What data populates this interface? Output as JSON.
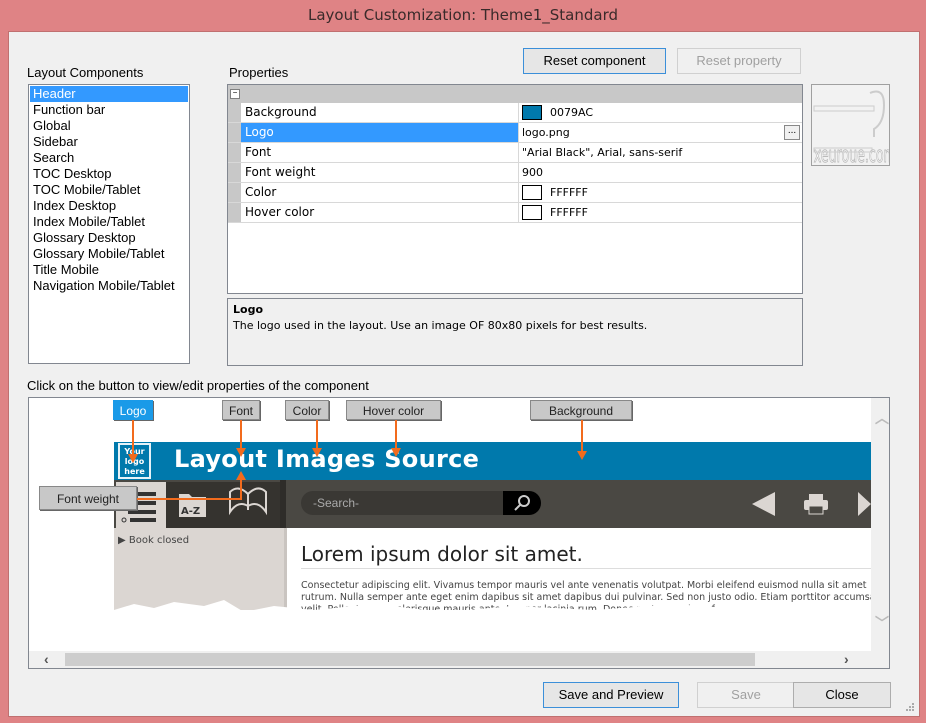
{
  "window": {
    "title": "Layout Customization: Theme1_Standard"
  },
  "toolbar": {
    "reset_component": "Reset component",
    "reset_property": "Reset property"
  },
  "components": {
    "label": "Layout Components",
    "items": [
      "Header",
      "Function bar",
      "Global",
      "Sidebar",
      "Search",
      "TOC Desktop",
      "TOC Mobile/Tablet",
      "Index Desktop",
      "Index Mobile/Tablet",
      "Glossary Desktop",
      "Glossary Mobile/Tablet",
      "Title Mobile",
      "Navigation Mobile/Tablet"
    ],
    "selected": "Header"
  },
  "properties": {
    "label": "Properties",
    "rows": [
      {
        "name": "Background",
        "value": "0079AC",
        "swatch": "#0079AC"
      },
      {
        "name": "Logo",
        "value": "logo.png",
        "selected": true,
        "browse": "..."
      },
      {
        "name": "Font",
        "value": "\"Arial Black\", Arial, sans-serif"
      },
      {
        "name": "Font weight",
        "value": "900"
      },
      {
        "name": "Color",
        "value": "FFFFFF",
        "swatch": "#FFFFFF"
      },
      {
        "name": "Hover color",
        "value": "FFFFFF",
        "swatch": "#FFFFFF"
      }
    ],
    "description": {
      "title": "Logo",
      "text": "The logo used in the layout. Use an image OF 80x80 pixels for best results."
    }
  },
  "thumbnail": {
    "alt_text": "xeuroue.com?"
  },
  "preview": {
    "instruction": "Click on the button to view/edit properties of the component",
    "buttons": {
      "logo": "Logo",
      "font": "Font",
      "color": "Color",
      "hover_color": "Hover color",
      "background": "Background",
      "font_weight": "Font weight"
    },
    "active_button": "Logo",
    "header_title": "Layout Images Source",
    "logo_placeholder": [
      "Your",
      "logo",
      "here"
    ],
    "search_placeholder": "-Search-",
    "sidebar_text": "Book closed",
    "az_label": "A-Z",
    "content_heading": "Lorem ipsum dolor sit amet.",
    "content_lines": [
      "Consectetur adipiscing elit. Vivamus tempor mauris vel ante venenatis volutpat. Morbi eleifend euismod nulla sit amet",
      "rutrum. Nulla semper ante eget enim dapibus sit amet dapibus dui pulvinar. Sed non justo odio. Etiam porttitor accumsan",
      "velit. Pellentesque celerisque mauris ante, tempor lacinia rum. Donec metus tristique f"
    ],
    "colors": {
      "header_bg": "#0079ac",
      "func_bar": "#4a4843",
      "sidebar": "#dbd6d2",
      "arrow": "#f26b1d",
      "active_btn": "#1a9ae8"
    }
  },
  "footer": {
    "save_preview": "Save and Preview",
    "save": "Save",
    "close": "Close"
  }
}
